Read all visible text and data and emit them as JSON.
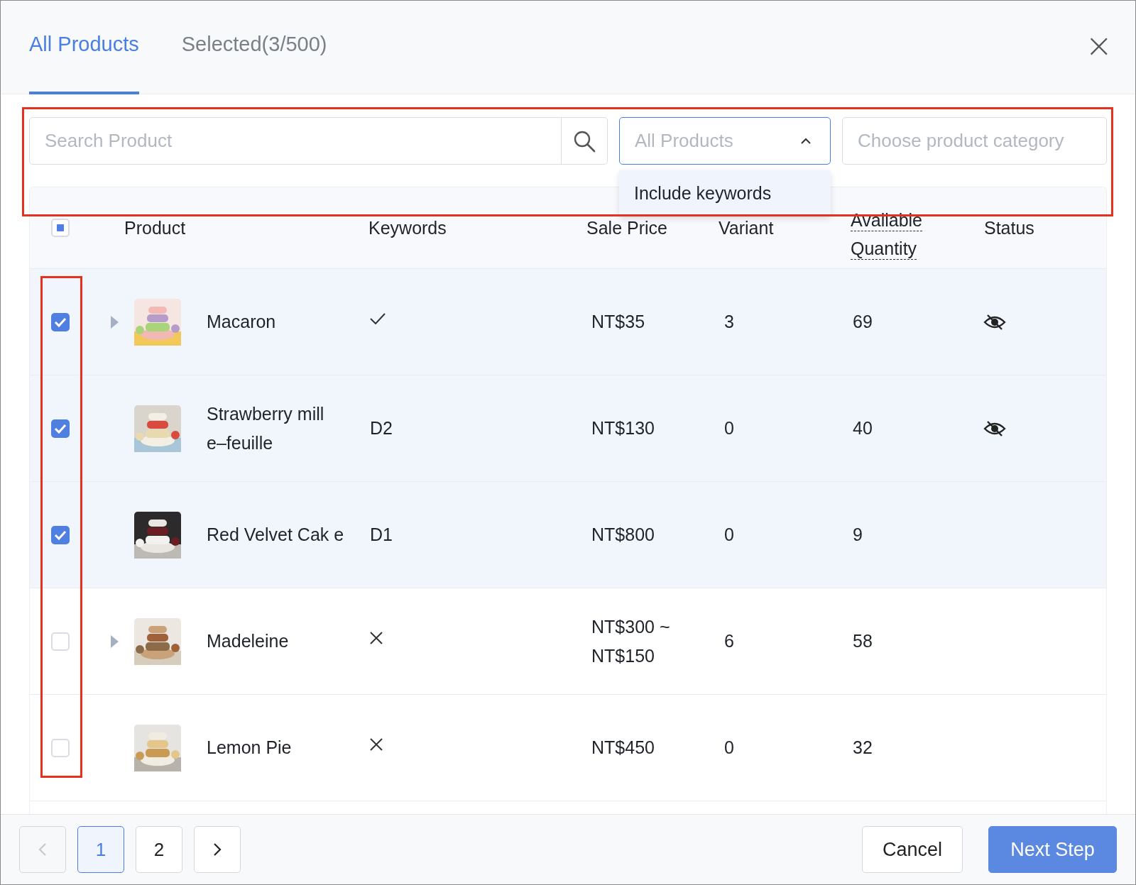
{
  "tabs": [
    {
      "label": "All Products",
      "selected": true
    },
    {
      "label": "Selected(3/500)",
      "selected": false
    }
  ],
  "close": "×",
  "search": {
    "placeholder": "Search Product"
  },
  "filter": {
    "placeholder": "All Products",
    "expanded": true,
    "options": [
      {
        "label": "Include keywords",
        "selected": false
      }
    ]
  },
  "category": {
    "placeholder": "Choose product category"
  },
  "table": {
    "indeterminate": true,
    "columns": [
      "Product",
      "Keywords",
      "Sale Price",
      "Variant",
      "Available Quantity",
      "Status"
    ],
    "rows": [
      {
        "checked": true,
        "expandable": true,
        "name": "Macaron",
        "keywords": {
          "kind": "check"
        },
        "price": "NT$35",
        "variant": "3",
        "quantity": "69",
        "hidden": true
      },
      {
        "checked": true,
        "expandable": false,
        "name": "Strawberry mill e–feuille",
        "keywords": {
          "kind": "text",
          "text": "D2"
        },
        "price": "NT$130",
        "variant": "0",
        "quantity": "40",
        "hidden": true
      },
      {
        "checked": true,
        "expandable": false,
        "name": "Red Velvet Cak e",
        "keywords": {
          "kind": "text",
          "text": "D1"
        },
        "price": "NT$800",
        "variant": "0",
        "quantity": "9",
        "hidden": false
      },
      {
        "checked": false,
        "expandable": true,
        "name": "Madeleine",
        "keywords": {
          "kind": "cross"
        },
        "price": "NT$300 ~ NT$150",
        "variant": "6",
        "quantity": "58",
        "hidden": false
      },
      {
        "checked": false,
        "expandable": false,
        "name": "Lemon Pie",
        "keywords": {
          "kind": "cross"
        },
        "price": "NT$450",
        "variant": "0",
        "quantity": "32",
        "hidden": false
      }
    ]
  },
  "pagination": {
    "pages": [
      {
        "label": "1",
        "selected": true
      },
      {
        "label": "2",
        "selected": false
      }
    ],
    "prev_disabled": true,
    "next_disabled": false
  },
  "buttons": [
    {
      "label": "Cancel",
      "kind": "secondary"
    },
    {
      "label": "Next Step",
      "kind": "primary"
    }
  ]
}
